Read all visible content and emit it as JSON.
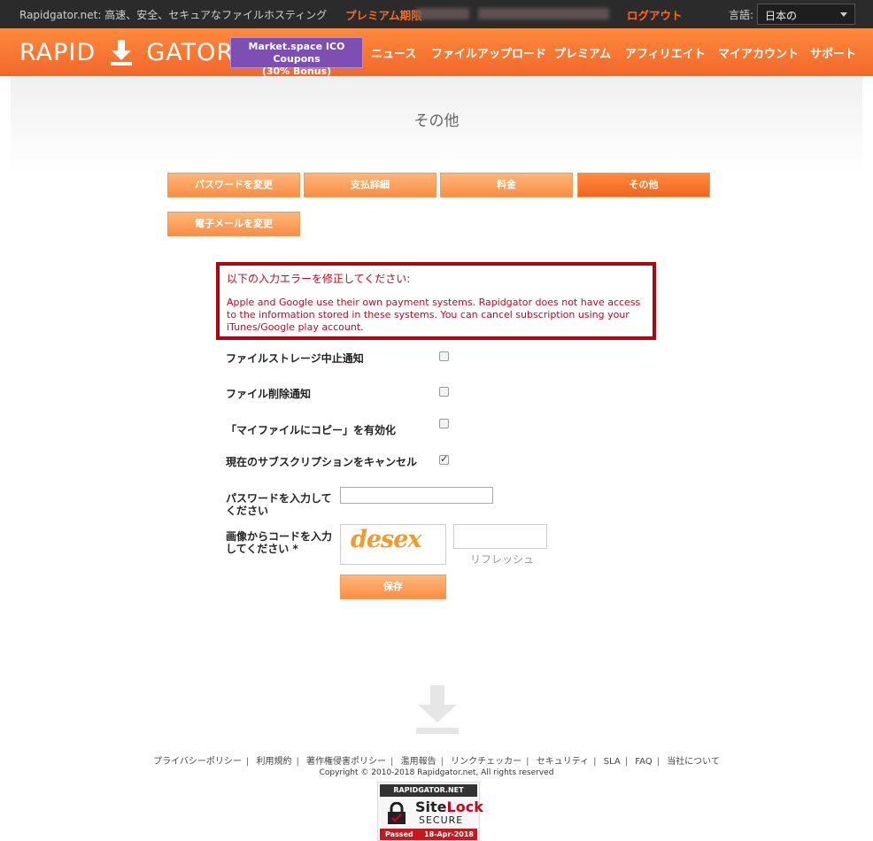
{
  "topbar": {
    "tagline": "Rapidgator.net: 高速、安全、セキュアなファイルホスティング",
    "premium_label": "プレミアム期限",
    "logout_label": "ログアウト",
    "language_label": "言語:",
    "language_selected": "日本の"
  },
  "header": {
    "logo_left": "RAPID",
    "logo_right": "GATOR",
    "promo_line1": "Market.space ICO Coupons",
    "promo_line2": "(30% Bonus)",
    "nav": [
      "ニュース",
      "ファイルアップロード",
      "プレミアム",
      "アフィリエイト",
      "マイアカウント",
      "サポート"
    ]
  },
  "page": {
    "title": "その他"
  },
  "tabs": [
    "パスワードを変更",
    "支払詳細",
    "料金",
    "その他",
    "電子メールを変更"
  ],
  "error": {
    "title": "以下の入力エラーを修正してください:",
    "message": "Apple and Google use their own payment systems. Rapidgator does not have access to the information stored in these systems. You can cancel subscription using your iTunes/Google play account."
  },
  "form": {
    "storage_notice_label": "ファイルストレージ中止通知",
    "storage_notice_checked": false,
    "deletion_notice_label": "ファイル削除通知",
    "deletion_notice_checked": false,
    "copy_enable_label": "「マイファイルにコピー」を有効化",
    "copy_enable_checked": false,
    "cancel_sub_label": "現在のサブスクリプションをキャンセル",
    "cancel_sub_checked": true,
    "password_label_1": "パスワードを入力して",
    "password_label_2": "ください",
    "captcha_label_1": "画像からコードを入力",
    "captcha_label_2": "してください *",
    "captcha_text": "desex",
    "refresh_label": "リフレッシュ",
    "save_label": "保存"
  },
  "footer": {
    "links": [
      "プライバシーポリシー",
      "利用規約",
      "著作権侵害ポリシー",
      "濫用報告",
      "リンクチェッカー",
      "セキュリティ",
      "SLA",
      "FAQ",
      "当社について"
    ],
    "copyright": "Copyright © 2010-2018 Rapidgator.net, All rights reserved",
    "sitelock_top": "RAPIDGATOR.NET",
    "sitelock_site": "Site",
    "sitelock_lock": "Lock",
    "sitelock_secure": "SECURE",
    "sitelock_passed": "Passed",
    "sitelock_date": "18-Apr-2018"
  },
  "colors": {
    "brand_orange": "#f2672a",
    "error_red": "#b1040e",
    "promo_purple": "#7d4fb3"
  }
}
